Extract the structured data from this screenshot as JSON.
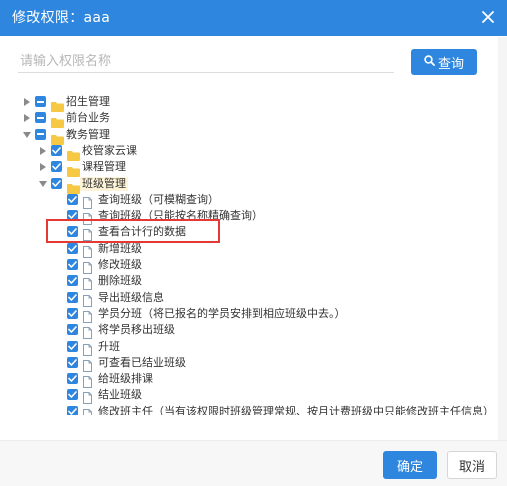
{
  "dialog": {
    "title": "修改权限：aaa",
    "search_placeholder": "请输入权限名称",
    "search_button": "查询",
    "ok_button": "确定",
    "cancel_button": "取消"
  },
  "colors": {
    "accent": "#2e86de",
    "highlight_box": "#e53935",
    "folder": "#f6c844"
  },
  "tree": [
    {
      "label": "招生管理",
      "level": 0,
      "caret": "right",
      "check": "partial",
      "icon": "folder-icon"
    },
    {
      "label": "前台业务",
      "level": 0,
      "caret": "right",
      "check": "partial",
      "icon": "folder-icon"
    },
    {
      "label": "教务管理",
      "level": 0,
      "caret": "down",
      "check": "partial",
      "icon": "folder-icon"
    },
    {
      "label": "校管家云课",
      "level": 1,
      "caret": "right",
      "check": "checked",
      "icon": "folder-icon"
    },
    {
      "label": "课程管理",
      "level": 1,
      "caret": "right",
      "check": "checked",
      "icon": "folder-icon"
    },
    {
      "label": "班级管理",
      "level": 1,
      "caret": "down",
      "check": "checked",
      "icon": "folder-icon",
      "selected": true
    },
    {
      "label": "查询班级（可模糊查询）",
      "level": 2,
      "check": "checked",
      "icon": "file-icon"
    },
    {
      "label": "查询班级（只能按名称精确查询）",
      "level": 2,
      "check": "checked",
      "icon": "file-icon"
    },
    {
      "label": "查看合计行的数据",
      "level": 2,
      "check": "checked",
      "icon": "file-icon"
    },
    {
      "label": "新增班级",
      "level": 2,
      "check": "checked",
      "icon": "file-icon"
    },
    {
      "label": "修改班级",
      "level": 2,
      "check": "checked",
      "icon": "file-icon"
    },
    {
      "label": "删除班级",
      "level": 2,
      "check": "checked",
      "icon": "file-icon"
    },
    {
      "label": "导出班级信息",
      "level": 2,
      "check": "checked",
      "icon": "file-icon"
    },
    {
      "label": "学员分班（将已报名的学员安排到相应班级中去。）",
      "level": 2,
      "check": "checked",
      "icon": "file-icon"
    },
    {
      "label": "将学员移出班级",
      "level": 2,
      "check": "checked",
      "icon": "file-icon"
    },
    {
      "label": "升班",
      "level": 2,
      "check": "checked",
      "icon": "file-icon"
    },
    {
      "label": "可查看已结业班级",
      "level": 2,
      "check": "checked",
      "icon": "file-icon"
    },
    {
      "label": "给班级排课",
      "level": 2,
      "check": "checked",
      "icon": "file-icon"
    },
    {
      "label": "结业班级",
      "level": 2,
      "check": "checked",
      "icon": "file-icon"
    },
    {
      "label": "修改班主任（当有该权限时班级管理常规、按月计费班级中只能修改班主任信息）",
      "level": 2,
      "check": "checked",
      "icon": "file-icon"
    }
  ]
}
